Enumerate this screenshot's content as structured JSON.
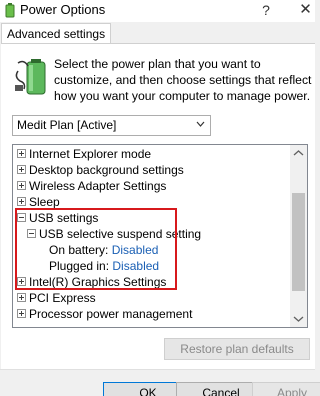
{
  "window": {
    "title": "Power Options",
    "help": "?",
    "close": "✕"
  },
  "tabs": [
    {
      "label": "Advanced settings"
    }
  ],
  "instruction": "Select the power plan that you want to customize, and then choose settings that reflect how you want your computer to manage power.",
  "plan_select": {
    "value": "Medit Plan [Active]"
  },
  "tree": {
    "items": [
      {
        "label": "Internet Explorer mode",
        "expander": "plus"
      },
      {
        "label": "Desktop background settings",
        "expander": "plus"
      },
      {
        "label": "Wireless Adapter Settings",
        "expander": "plus"
      },
      {
        "label": "Sleep",
        "expander": "plus"
      },
      {
        "label": "USB settings",
        "expander": "minus"
      },
      {
        "label": "USB selective suspend setting",
        "expander": "minus"
      },
      {
        "label": "On battery:",
        "value": "Disabled"
      },
      {
        "label": "Plugged in:",
        "value": "Disabled"
      },
      {
        "label": "Intel(R) Graphics Settings",
        "expander": "plus"
      },
      {
        "label": "PCI Express",
        "expander": "plus"
      },
      {
        "label": "Processor power management",
        "expander": "plus"
      }
    ]
  },
  "buttons": {
    "restore": "Restore plan defaults",
    "ok": "OK",
    "cancel": "Cancel",
    "apply": "Apply"
  },
  "colors": {
    "highlight": "#d7191c",
    "setting_value": "#1a5fb4"
  }
}
